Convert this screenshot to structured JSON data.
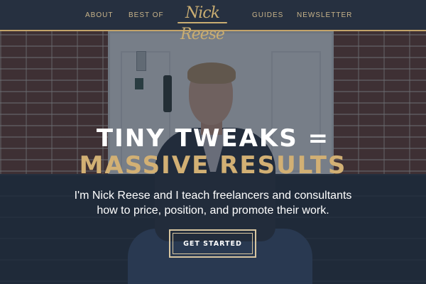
{
  "nav": {
    "links": [
      "ABOUT",
      "BEST OF",
      "GUIDES",
      "NEWSLETTER"
    ],
    "logo": "Nick Reese"
  },
  "hero": {
    "headline_line1": "TINY TWEAKS =",
    "headline_line2": "MASSIVE RESULTS",
    "subtext": "I'm Nick Reese and I teach freelancers and consultants how to price, position, and promote their work.",
    "cta_label": "GET STARTED"
  },
  "colors": {
    "nav_bg": "#263040",
    "accent_gold": "#c9ad72",
    "headline_gold": "#d2b074",
    "overlay": "#1a2434"
  }
}
